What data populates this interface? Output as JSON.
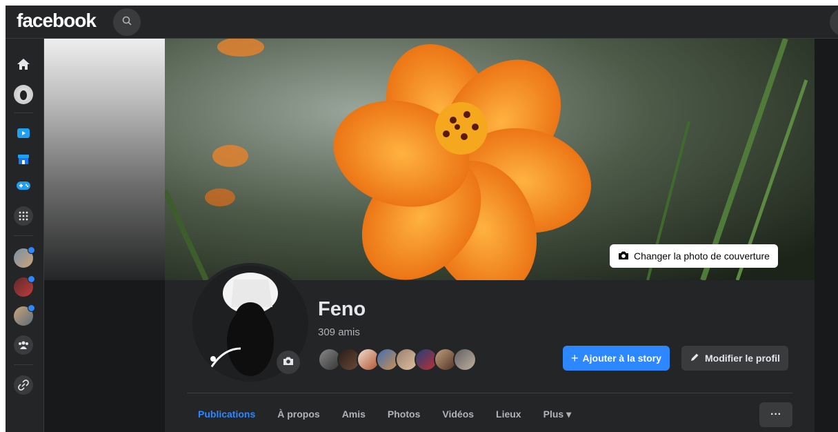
{
  "topbar": {
    "logo": "facebook",
    "search_icon": "search-icon"
  },
  "rail": {
    "items": [
      {
        "name": "home-icon"
      },
      {
        "name": "profile-shortcut"
      },
      {
        "name": "watch-icon"
      },
      {
        "name": "marketplace-icon"
      },
      {
        "name": "gaming-icon"
      },
      {
        "name": "menu-grid-icon"
      },
      {
        "name": "group-shortcut-1",
        "badge": true
      },
      {
        "name": "group-shortcut-2",
        "badge": true
      },
      {
        "name": "group-shortcut-3",
        "badge": true
      },
      {
        "name": "groups-icon"
      },
      {
        "name": "link-icon"
      }
    ]
  },
  "cover": {
    "change_label": "Changer la photo de couverture"
  },
  "profile": {
    "name": "Feno",
    "friends_count": "309 amis"
  },
  "actions": {
    "add_story": "Ajouter à la story",
    "add_story_icon": "+",
    "edit_profile": "Modifier le profil"
  },
  "tabs": [
    {
      "label": "Publications",
      "active": true
    },
    {
      "label": "À propos"
    },
    {
      "label": "Amis"
    },
    {
      "label": "Photos"
    },
    {
      "label": "Vidéos"
    },
    {
      "label": "Lieux"
    },
    {
      "label": "Plus ▾"
    }
  ],
  "more_button": "···",
  "colors": {
    "accent": "#2d88ff",
    "background": "#18191a",
    "surface": "#242526",
    "flower": "#f07d1a"
  }
}
